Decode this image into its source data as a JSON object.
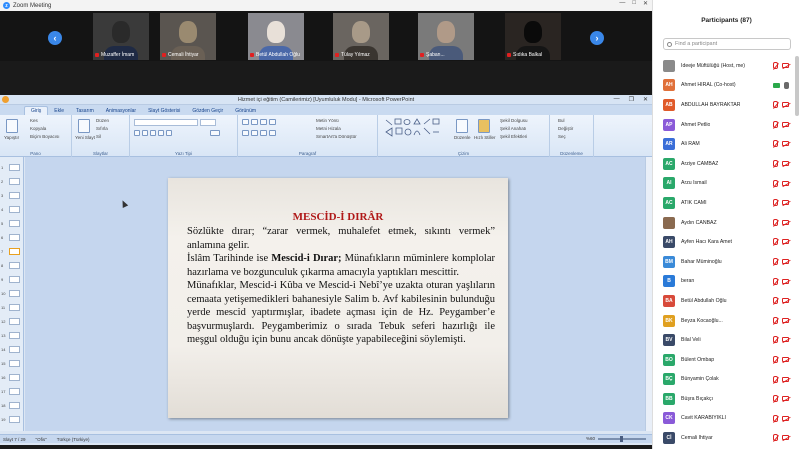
{
  "window": {
    "title": "Zoom Meeting"
  },
  "gallery": {
    "tiles": [
      {
        "name": "Muzaffer İmam"
      },
      {
        "name": "Cemali İhtiyar"
      },
      {
        "name": "Betül Abdullah Oğlu"
      },
      {
        "name": "Tülay Yılmaz"
      },
      {
        "name": "Şaban..."
      },
      {
        "name": "Sıdıka Balkal"
      }
    ]
  },
  "ppt": {
    "window_title": "Hizmet içi eğitim (Camilerimiz) [Uyumluluk Modu] - Microsoft PowerPoint",
    "tabs": [
      "Giriş",
      "Ekle",
      "Tasarım",
      "Animasyonlar",
      "Slayt Gösterisi",
      "Gözden Geçir",
      "Görünüm"
    ],
    "ribbon": {
      "groups": [
        "Pano",
        "Slaytlar",
        "Yazı Tipi",
        "Paragraf",
        "Çizim",
        "Düzenleme"
      ],
      "paste": "Yapıştır",
      "cut": "Kes",
      "copy": "Kopyala",
      "format_painter": "Biçim Boyacısı",
      "new_slide": "Yeni Slayt",
      "layout": "Düzen",
      "reset": "Sıfırla",
      "delete": "Sil",
      "text_direction": "Metin Yönü",
      "align_text": "Metni Hizala",
      "smartart": "SmartArt'a Dönüştür",
      "arrange": "Düzenle",
      "quick_styles": "Hızlı Stiller",
      "shape_fill": "Şekil Dolgusu",
      "shape_outline": "Şekil Anahatı",
      "shape_effects": "Şekil Efektleri",
      "find": "Bul",
      "replace": "Değiştir",
      "select": "Seç"
    },
    "status": {
      "slide": "Slayt 7 / 29",
      "theme": "\"Ofis\"",
      "language": "Türkçe (Türkiye)",
      "zoom": "%60"
    }
  },
  "slide": {
    "title": "MESCİD-İ DIRÂR",
    "p1": "Sözlükte dırar; “zarar vermek, muhalefet etmek, sıkıntı vermek” anlamına gelir.",
    "p2_pre": "İslâm Tarihinde ise ",
    "p2_bold": "Mescid-i Dırar;",
    "p2_post": " Münafıkların müminlere komplolar hazırlama ve bozgunculuk çıkarma amacıyla yaptıkları mescittir.",
    "p3": "Münafıklar, Mescid-i Kûba ve Mescid-i Nebî’ye uzakta oturan yaşlıların cemaata yetişemedikleri bahanesiyle Salim b. Avf kabilesinin bulunduğu yerde mescid yaptırmışlar, ibadete açması için de Hz. Peygamber’e başvurmuşlardı. Peygamberimiz o sırada Tebuk seferi hazırlığı ile meşgul olduğu için bunu ancak dönüşte yapabileceğini söylemişti."
  },
  "participants": {
    "header": "Participants (87)",
    "search_placeholder": "Find a participant",
    "list": [
      {
        "initials": "",
        "name": "İdeeje Müftülüğü (Host, me)",
        "color": "#8a8a8a",
        "mic": "muted",
        "cam": "off"
      },
      {
        "initials": "AH",
        "name": "Ahmet HİRAL (Co-host)",
        "color": "#e0703a",
        "mic": "on",
        "cam": "on"
      },
      {
        "initials": "AB",
        "name": "ABDULLAH BAYRAKTAR",
        "color": "#e05a2a",
        "mic": "muted",
        "cam": "off"
      },
      {
        "initials": "AP",
        "name": "Ahmet Petlio",
        "color": "#8a5ad8",
        "mic": "muted",
        "cam": "off"
      },
      {
        "initials": "AR",
        "name": "Ali RAM",
        "color": "#3a6ed8",
        "mic": "muted",
        "cam": "off"
      },
      {
        "initials": "AC",
        "name": "Arziye CAMBAZ",
        "color": "#2aa86a",
        "mic": "muted",
        "cam": "off"
      },
      {
        "initials": "AI",
        "name": "Arzu İsmail",
        "color": "#2aa86a",
        "mic": "muted",
        "cam": "off"
      },
      {
        "initials": "AC",
        "name": "ATIK CAMİ",
        "color": "#2aa86a",
        "mic": "muted",
        "cam": "off"
      },
      {
        "initials": "",
        "name": "Aydın CANBAZ",
        "color": "#8a6a50",
        "mic": "muted",
        "cam": "off"
      },
      {
        "initials": "AH",
        "name": "Ayfen Hacı Kara Amet",
        "color": "#3a4a68",
        "mic": "muted",
        "cam": "off"
      },
      {
        "initials": "BM",
        "name": "Bahar Müminoğlu",
        "color": "#3a8ad8",
        "mic": "muted",
        "cam": "off"
      },
      {
        "initials": "B",
        "name": "beran",
        "color": "#2a7ad8",
        "mic": "muted",
        "cam": "off"
      },
      {
        "initials": "BA",
        "name": "Betül Abdullah Oğlu",
        "color": "#d84a3a",
        "mic": "muted",
        "cam": "off"
      },
      {
        "initials": "BK",
        "name": "Beyza Kocaoğlu...",
        "color": "#e0a020",
        "mic": "muted",
        "cam": "off"
      },
      {
        "initials": "BV",
        "name": "Bilal Veli",
        "color": "#3a4a68",
        "mic": "muted",
        "cam": "off"
      },
      {
        "initials": "BO",
        "name": "Bülent Ombap",
        "color": "#2aa86a",
        "mic": "muted",
        "cam": "off"
      },
      {
        "initials": "BÇ",
        "name": "Bünyamin Çolak",
        "color": "#2aa86a",
        "mic": "muted",
        "cam": "off"
      },
      {
        "initials": "BB",
        "name": "Büşra Bıçakçı",
        "color": "#2aa86a",
        "mic": "muted",
        "cam": "off"
      },
      {
        "initials": "CK",
        "name": "Cavit KARABIYIKLI",
        "color": "#8a5ad8",
        "mic": "muted",
        "cam": "off"
      },
      {
        "initials": "Cİ",
        "name": "Cemali İhtiyar",
        "color": "#3a4a68",
        "mic": "muted",
        "cam": "off"
      }
    ]
  }
}
